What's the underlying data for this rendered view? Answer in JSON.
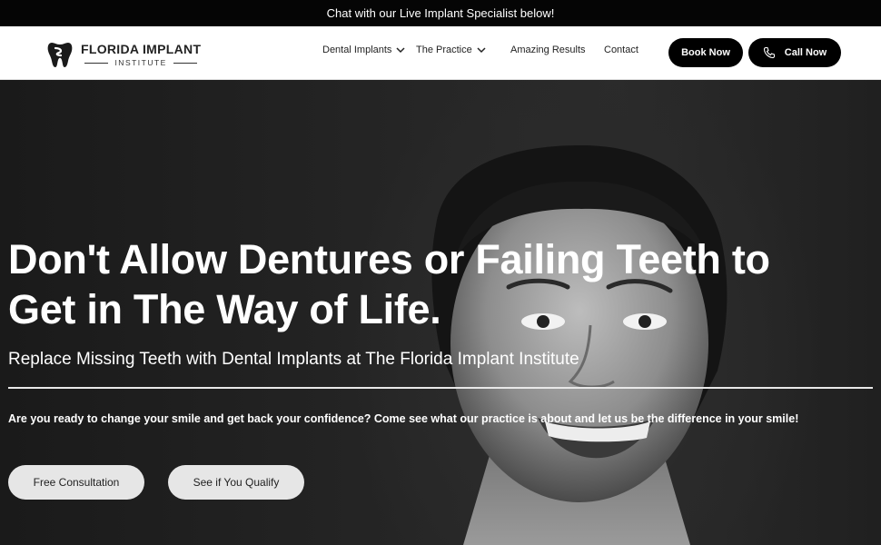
{
  "topbar": {
    "text": "Chat with our Live Implant Specialist below!"
  },
  "header": {
    "logo": {
      "title": "FLORIDA IMPLANT",
      "subtitle": "INSTITUTE",
      "icon": "tooth-logo-icon"
    },
    "nav": [
      {
        "label": "Dental Implants",
        "has_dropdown": true
      },
      {
        "label": "The Practice",
        "has_dropdown": true
      },
      {
        "label": "Amazing Results",
        "has_dropdown": false
      },
      {
        "label": "Contact",
        "has_dropdown": false
      }
    ],
    "book_now": "Book Now",
    "call_now": {
      "label": "Call Now",
      "icon": "phone-icon"
    }
  },
  "hero": {
    "title_line1": "Don't Allow Dentures or Failing Teeth to",
    "title_line2": "Get in The Way of Life.",
    "subtitle": "Replace Missing Teeth with Dental Implants at The Florida Implant Institute",
    "body": "Are you ready to change your smile and get back your confidence? Come see what our practice is about and let us be the difference in your smile!",
    "cta_primary": "Free Consultation",
    "cta_secondary": "See if You Qualify"
  },
  "colors": {
    "topbar_bg": "#050505",
    "header_bg": "#ffffff",
    "button_dark": "#000000",
    "button_light": "#e6e6e6",
    "hero_text": "#ffffff"
  }
}
